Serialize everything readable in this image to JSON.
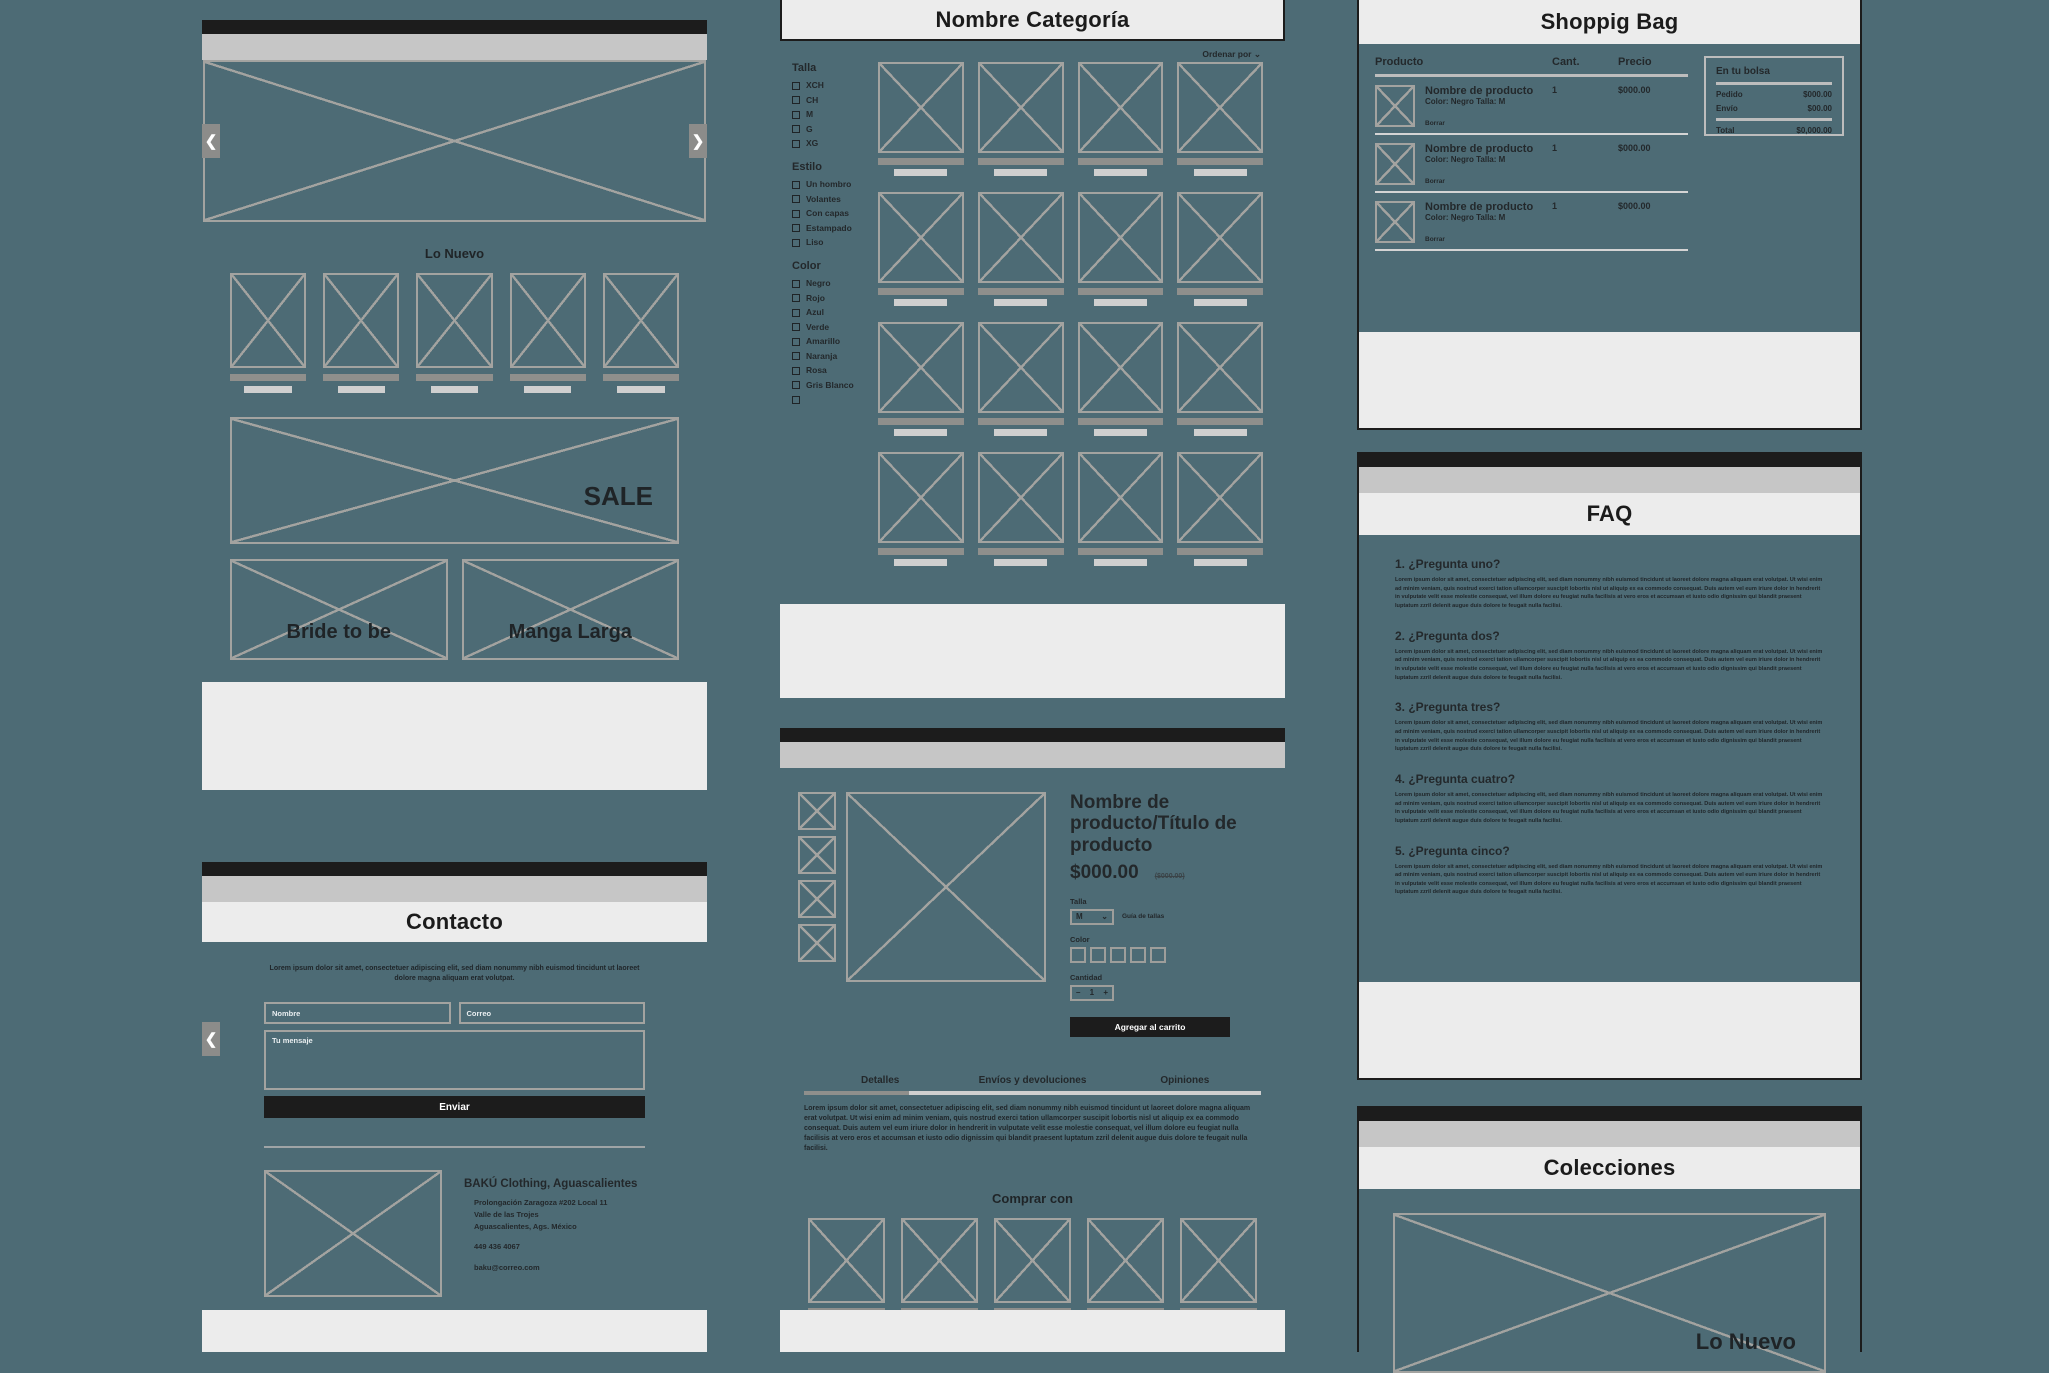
{
  "canvas": {
    "background": "#4d6b75",
    "placeholder_stroke": "#a3a3a0"
  },
  "home": {
    "hero_prev_icon": "chevron-left-icon",
    "hero_next_icon": "chevron-right-icon",
    "section_new": "Lo Nuevo",
    "sale_label": "SALE",
    "tile_bride": "Bride to be",
    "tile_manga": "Manga Larga",
    "product_count": 5
  },
  "category": {
    "title": "Nombre Categoría",
    "sort_label": "Ordenar por",
    "sort_icon": "chevron-down-icon",
    "filters": [
      {
        "heading": "Talla",
        "options": [
          "XCH",
          "CH",
          "M",
          "G",
          "XG"
        ]
      },
      {
        "heading": "Estilo",
        "options": [
          "Un hombro",
          "Volantes",
          "Con capas",
          "Estampado",
          "Liso"
        ]
      },
      {
        "heading": "Color",
        "options": [
          "Negro",
          "Rojo",
          "Azul",
          "Verde",
          "Amarillo",
          "Naranja",
          "Rosa",
          "Gris Blanco",
          ""
        ]
      }
    ],
    "grid_columns": 4,
    "grid_rows": 4
  },
  "cart": {
    "title": "Shoppig Bag",
    "columns": [
      "Producto",
      "Cant.",
      "Precio"
    ],
    "rows": [
      {
        "name": "Nombre de producto",
        "variant": "Color: Negro Talla: M",
        "remove": "Borrar",
        "qty": "1",
        "price": "$000.00"
      },
      {
        "name": "Nombre de producto",
        "variant": "Color: Negro Talla: M",
        "remove": "Borrar",
        "qty": "1",
        "price": "$000.00"
      },
      {
        "name": "Nombre de producto",
        "variant": "Color: Negro Talla: M",
        "remove": "Borrar",
        "qty": "1",
        "price": "$000.00"
      }
    ],
    "summary": {
      "title": "En tu bolsa",
      "lines": [
        {
          "label": "Pedido",
          "value": "$000.00"
        },
        {
          "label": "Envío",
          "value": "$00.00"
        }
      ],
      "total_label": "Total",
      "total_value": "$0,000.00"
    }
  },
  "faq": {
    "title": "FAQ",
    "items": [
      {
        "q": "1. ¿Pregunta uno?",
        "a": "Lorem ipsum dolor sit amet, consectetuer adipiscing elit, sed diam nonummy nibh euismod tincidunt ut laoreet dolore magna aliquam erat volutpat. Ut wisi enim ad minim veniam, quis nostrud exerci tation ullamcorper suscipit lobortis nisl ut aliquip ex ea commodo consequat. Duis autem vel eum iriure dolor in hendrerit in vulputate velit esse molestie consequat, vel illum dolore eu feugiat nulla facilisis at vero eros et accumsan et iusto odio dignissim qui blandit praesent luptatum zzril delenit augue duis dolore te feugait nulla facilisi."
      },
      {
        "q": "2. ¿Pregunta dos?",
        "a": "Lorem ipsum dolor sit amet, consectetuer adipiscing elit, sed diam nonummy nibh euismod tincidunt ut laoreet dolore magna aliquam erat volutpat. Ut wisi enim ad minim veniam, quis nostrud exerci tation ullamcorper suscipit lobortis nisl ut aliquip ex ea commodo consequat. Duis autem vel eum iriure dolor in hendrerit in vulputate velit esse molestie consequat, vel illum dolore eu feugiat nulla facilisis at vero eros et accumsan et iusto odio dignissim qui blandit praesent luptatum zzril delenit augue duis dolore te feugait nulla facilisi."
      },
      {
        "q": "3. ¿Pregunta tres?",
        "a": "Lorem ipsum dolor sit amet, consectetuer adipiscing elit, sed diam nonummy nibh euismod tincidunt ut laoreet dolore magna aliquam erat volutpat. Ut wisi enim ad minim veniam, quis nostrud exerci tation ullamcorper suscipit lobortis nisl ut aliquip ex ea commodo consequat. Duis autem vel eum iriure dolor in hendrerit in vulputate velit esse molestie consequat, vel illum dolore eu feugiat nulla facilisis at vero eros et accumsan et iusto odio dignissim qui blandit praesent luptatum zzril delenit augue duis dolore te feugait nulla facilisi."
      },
      {
        "q": "4. ¿Pregunta cuatro?",
        "a": "Lorem ipsum dolor sit amet, consectetuer adipiscing elit, sed diam nonummy nibh euismod tincidunt ut laoreet dolore magna aliquam erat volutpat. Ut wisi enim ad minim veniam, quis nostrud exerci tation ullamcorper suscipit lobortis nisl ut aliquip ex ea commodo consequat. Duis autem vel eum iriure dolor in hendrerit in vulputate velit esse molestie consequat, vel illum dolore eu feugiat nulla facilisis at vero eros et accumsan et iusto odio dignissim qui blandit praesent luptatum zzril delenit augue duis dolore te feugait nulla facilisi."
      },
      {
        "q": "5. ¿Pregunta cinco?",
        "a": "Lorem ipsum dolor sit amet, consectetuer adipiscing elit, sed diam nonummy nibh euismod tincidunt ut laoreet dolore magna aliquam erat volutpat. Ut wisi enim ad minim veniam, quis nostrud exerci tation ullamcorper suscipit lobortis nisl ut aliquip ex ea commodo consequat. Duis autem vel eum iriure dolor in hendrerit in vulputate velit esse molestie consequat, vel illum dolore eu feugiat nulla facilisis at vero eros et accumsan et iusto odio dignissim qui blandit praesent luptatum zzril delenit augue duis dolore te feugait nulla facilisi."
      }
    ]
  },
  "collections": {
    "title": "Colecciones",
    "tile_label": "Lo Nuevo"
  },
  "contact": {
    "title": "Contacto",
    "intro": "Lorem ipsum dolor sit amet, consectetuer adipiscing elit, sed diam nonummy nibh euismod tincidunt ut laoreet dolore magna aliquam erat volutpat.",
    "fields": {
      "name": "Nombre",
      "email": "Correo",
      "message": "Tu mensaje"
    },
    "submit": "Enviar",
    "prev_icon": "chevron-left-icon",
    "store": {
      "name": "BAKÚ Clothing, Aguascalientes",
      "address1": "Prolongación Zaragoza #202 Local 11",
      "address2": "Valle de las Trojes",
      "address3": "Aguascalientes, Ags. México",
      "phone": "449 436 4067",
      "email": "baku@correo.com"
    }
  },
  "product": {
    "title": "Nombre de producto/Título de producto",
    "price": "$000.00",
    "old_price": "($000.00)",
    "size_label": "Talla",
    "size_value": "M",
    "size_guide": "Guía de tallas",
    "color_label": "Color",
    "swatch_count": 5,
    "qty_label": "Cantidad",
    "qty_value": "1",
    "qty_minus": "–",
    "qty_plus": "+",
    "add_to_cart": "Agregar al carrito",
    "tabs": [
      "Detalles",
      "Envíos y devoluciones",
      "Opiniones"
    ],
    "active_tab": "Detalles",
    "details_text": "Lorem ipsum dolor sit amet, consectetuer adipiscing elit, sed diam nonummy nibh euismod tincidunt ut laoreet dolore magna aliquam erat volutpat. Ut wisi enim ad minim veniam, quis nostrud exerci tation ullamcorper suscipit lobortis nisl ut aliquip ex ea commodo consequat. Duis autem vel eum iriure dolor in hendrerit in vulputate velit esse molestie consequat, vel illum dolore eu feugiat nulla facilisis at vero eros et accumsan et iusto odio dignissim qui blandit praesent luptatum zzril delenit augue duis dolore te feugait nulla facilisi.",
    "related_title": "Comprar con",
    "thumb_count": 4,
    "related_count": 5
  }
}
